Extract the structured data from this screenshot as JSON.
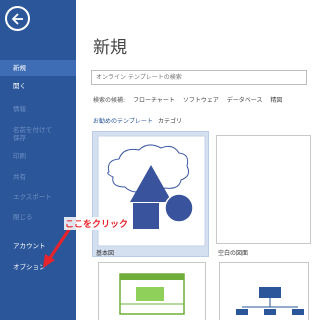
{
  "sidebar": {
    "back_icon": "back-arrow-icon",
    "items": {
      "new": "新規",
      "open": "開く",
      "info": "情報",
      "save_as_line1": "名前を付けて",
      "save_as_line2": "保存",
      "print": "印刷",
      "share": "共有",
      "export": "エクスポート",
      "close": "閉じる",
      "account": "アカウント",
      "options": "オプション"
    },
    "colors": {
      "background": "#2b579a",
      "selected": "#3e6db5"
    }
  },
  "main": {
    "title": "新規",
    "search": {
      "placeholder": "オンライン テンプレートの検索"
    },
    "suggested": {
      "label": "検索の候補:",
      "items": [
        "フローチャート",
        "ソフトウェア",
        "データベース",
        "精図"
      ]
    },
    "tabs": {
      "featured": "お勧めのテンプレート",
      "category": "カテゴリ"
    },
    "templates": {
      "basic": "基本図",
      "blank": "空白の図面"
    }
  },
  "annotation": {
    "text": "ここをクリック",
    "color": "#e8232a"
  }
}
